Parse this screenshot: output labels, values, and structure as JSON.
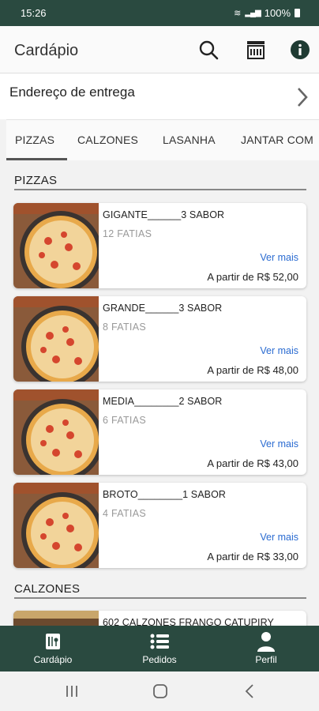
{
  "status_bar": {
    "time": "15:26",
    "battery": "100%"
  },
  "header": {
    "title": "Cardápio",
    "icons": [
      "search-icon",
      "store-icon",
      "info-icon"
    ]
  },
  "address": {
    "label": "Endereço de entrega"
  },
  "tabs": [
    {
      "label": "PIZZAS",
      "selected": true
    },
    {
      "label": "CALZONES",
      "selected": false
    },
    {
      "label": "LASANHA",
      "selected": false
    },
    {
      "label": "JANTAR COM",
      "selected": false
    }
  ],
  "sections": [
    {
      "title": "PIZZAS",
      "items": [
        {
          "name": "GIGANTE______3 SABOR",
          "slices": "12 FATIAS",
          "more": "Ver mais",
          "price": "A partir de  R$ 52,00"
        },
        {
          "name": "GRANDE______3 SABOR",
          "slices": "8 FATIAS",
          "more": "Ver mais",
          "price": "A partir de  R$ 48,00"
        },
        {
          "name": "MEDIA________2 SABOR",
          "slices": "6 FATIAS",
          "more": "Ver mais",
          "price": "A partir de  R$ 43,00"
        },
        {
          "name": "BROTO________1 SABOR",
          "slices": "4 FATIAS",
          "more": "Ver mais",
          "price": "A partir de  R$ 33,00"
        }
      ]
    },
    {
      "title": "CALZONES",
      "items": [
        {
          "name": "602 CALZONES FRANGO CATUPIRY"
        }
      ]
    }
  ],
  "bottom_nav": [
    {
      "label": "Cardápio",
      "icon": "menu-book-icon"
    },
    {
      "label": "Pedidos",
      "icon": "list-icon"
    },
    {
      "label": "Perfil",
      "icon": "person-icon"
    }
  ],
  "colors": {
    "primary": "#2a4a40",
    "link": "#2a6bd1",
    "background": "#f2f2f2"
  }
}
